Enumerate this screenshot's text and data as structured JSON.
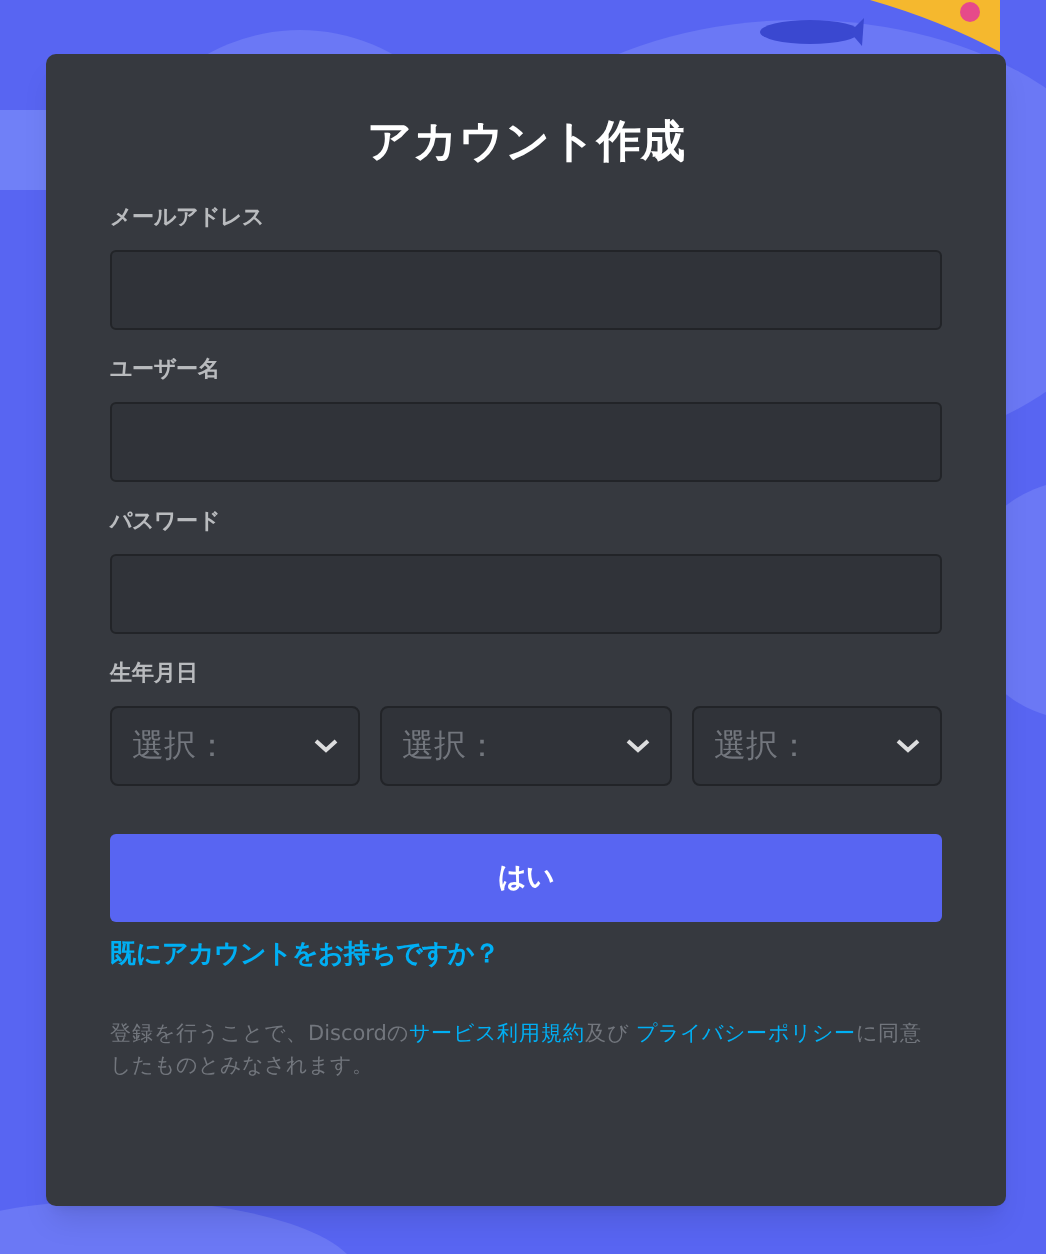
{
  "title": "アカウント作成",
  "fields": [
    {
      "label": "メールアドレス"
    },
    {
      "label": "ユーザー名"
    },
    {
      "label": "パスワード"
    }
  ],
  "birthday": {
    "label": "生年月日",
    "selects": [
      {
        "placeholder": "選択："
      },
      {
        "placeholder": "選択："
      },
      {
        "placeholder": "選択："
      }
    ]
  },
  "submit": "はい",
  "login_link": "既にアカウントをお持ちですか？",
  "terms": {
    "before": "登録を行うことで、Discordの",
    "link_1": "サービス利用規約",
    "middle": "及び ",
    "link_2": "プライバシーポリシー",
    "after": "に同意したものとみなされます。"
  }
}
